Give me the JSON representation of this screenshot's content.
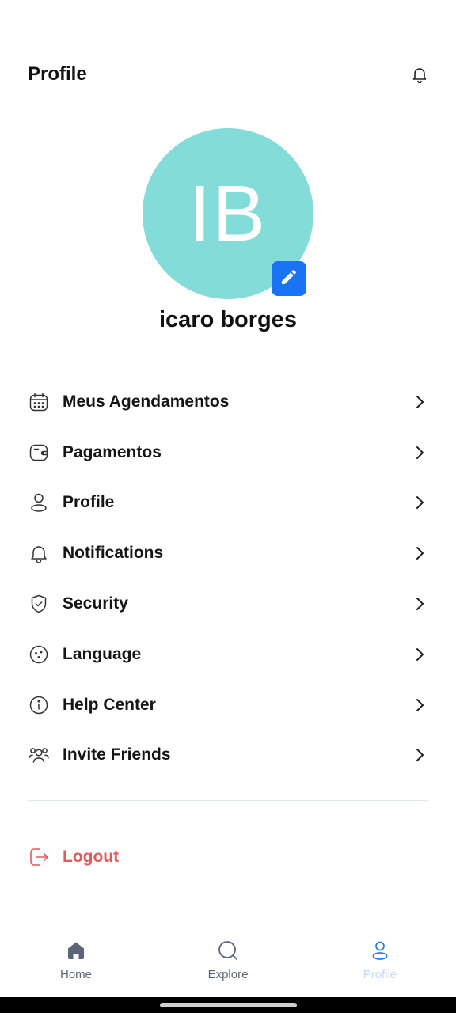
{
  "header": {
    "title": "Profile",
    "notification_icon": "bell-icon"
  },
  "profile": {
    "initials": "IB",
    "name": "icaro borges",
    "avatar_color": "#84dcd8",
    "edit_icon": "pencil-icon",
    "edit_button_color": "#1a73f5"
  },
  "menu": {
    "items": [
      {
        "label": "Meus Agendamentos",
        "icon": "calendar-icon"
      },
      {
        "label": "Pagamentos",
        "icon": "wallet-icon"
      },
      {
        "label": "Profile",
        "icon": "user-icon"
      },
      {
        "label": "Notifications",
        "icon": "bell-icon"
      },
      {
        "label": "Security",
        "icon": "shield-check-icon"
      },
      {
        "label": "Language",
        "icon": "globe-icon"
      },
      {
        "label": "Help Center",
        "icon": "info-icon"
      },
      {
        "label": "Invite Friends",
        "icon": "users-icon"
      }
    ],
    "chevron_icon": "chevron-right-icon"
  },
  "logout": {
    "label": "Logout",
    "icon": "logout-icon",
    "color": "#e25a5a"
  },
  "bottom_nav": {
    "items": [
      {
        "label": "Home",
        "icon": "home-icon",
        "active": false
      },
      {
        "label": "Explore",
        "icon": "search-icon",
        "active": false
      },
      {
        "label": "Profile",
        "icon": "user-icon",
        "active": true
      }
    ],
    "active_color": "#c5d9f7",
    "inactive_color": "#5b6577"
  }
}
